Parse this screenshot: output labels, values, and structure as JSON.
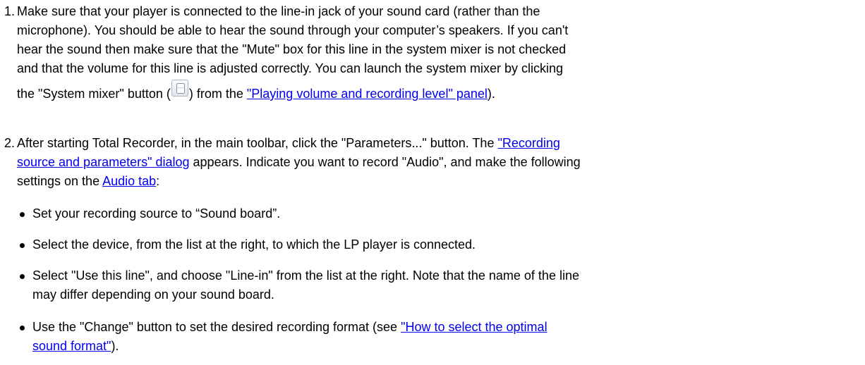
{
  "step1": {
    "number": "1.",
    "line1": "Make sure that your player is connected to the line-in jack of your sound card (rather than the",
    "line2": "microphone). You should be able to hear the sound through your computer’s speakers. If you can't",
    "line3": "hear the sound then make sure that the \"Mute\" box for this line in the system mixer is not checked",
    "line4": "and that the volume for this line is adjusted correctly. You can launch the system mixer by clicking",
    "line5_pre": "the \"System mixer\" button (",
    "line5_mid": ") from the ",
    "link": "\"Playing volume and recording level\" panel",
    "line5_post": ").",
    "mixer_icon": "system-mixer-icon"
  },
  "step2": {
    "number": "2.",
    "line1_pre": "After starting Total Recorder, in the main toolbar, click the \"Parameters...\" button. The ",
    "link1_part1": "\"Recording",
    "link1_part2": "source and parameters\" dialog",
    "line2_post": " appears. Indicate you want to record \"Audio\", and make the following",
    "line3_pre": "settings on the ",
    "link2": "Audio tab",
    "line3_post": ":"
  },
  "bullets": {
    "b1": "Set your recording source to “Sound board”.",
    "b2": "Select the device, from the list at the right, to which the LP player is connected.",
    "b3_line1": "Select \"Use this line\", and choose \"Line-in\" from the list at the right. Note that the name of the line",
    "b3_line2": "may differ depending on your sound board.",
    "b4_pre": "Use the \"Change\" button to set the desired recording format (see ",
    "b4_link1": "\"How to select the optimal",
    "b4_link2": "sound format\"",
    "b4_post": ")."
  }
}
